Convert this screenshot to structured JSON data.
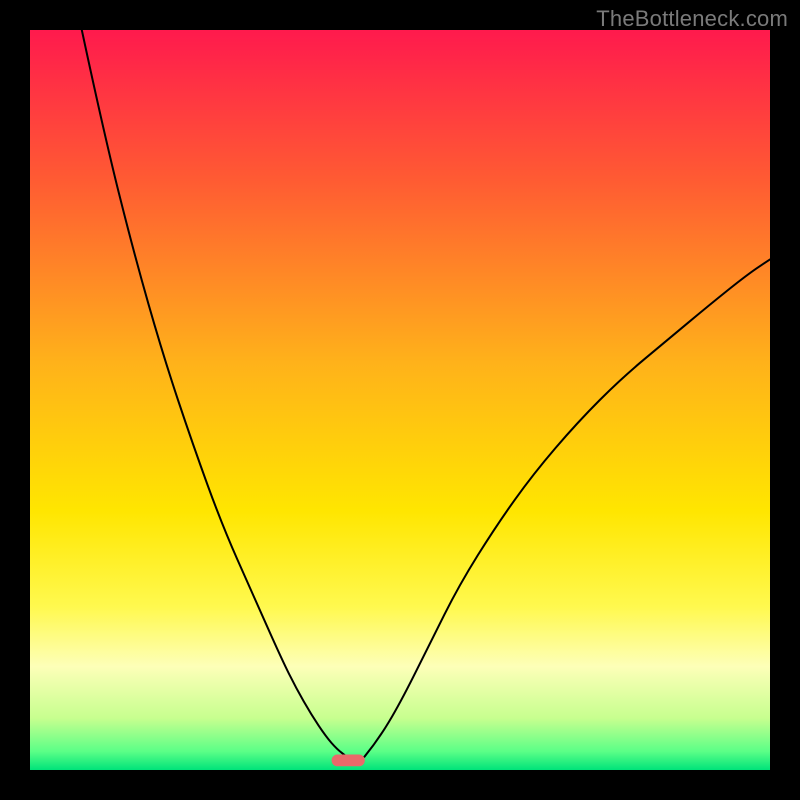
{
  "watermark": "TheBottleneck.com",
  "chart_data": {
    "type": "line",
    "title": "",
    "xlabel": "",
    "ylabel": "",
    "xlim": [
      0,
      100
    ],
    "ylim": [
      0,
      100
    ],
    "grid": false,
    "legend": false,
    "background_gradient_stops": [
      {
        "offset": 0.0,
        "color": "#ff1a4d"
      },
      {
        "offset": 0.2,
        "color": "#ff5a33"
      },
      {
        "offset": 0.45,
        "color": "#ffb21a"
      },
      {
        "offset": 0.65,
        "color": "#ffe600"
      },
      {
        "offset": 0.78,
        "color": "#fff94f"
      },
      {
        "offset": 0.86,
        "color": "#fdffb8"
      },
      {
        "offset": 0.93,
        "color": "#c7ff8f"
      },
      {
        "offset": 0.975,
        "color": "#5bff87"
      },
      {
        "offset": 1.0,
        "color": "#00e37a"
      }
    ],
    "optimum_marker": {
      "x": 43,
      "y": 1.3,
      "width": 4.5,
      "height": 1.6,
      "color": "#e96a6a"
    },
    "series": [
      {
        "name": "left-curve",
        "color": "#000000",
        "stroke_width": 2,
        "x": [
          7.0,
          10,
          14,
          18,
          22,
          26,
          30,
          34,
          36,
          38,
          40,
          41.5,
          42.8
        ],
        "y": [
          100,
          86,
          70,
          56,
          44,
          33,
          24,
          15,
          11,
          7.5,
          4.5,
          2.8,
          1.8
        ]
      },
      {
        "name": "right-curve",
        "color": "#000000",
        "stroke_width": 2,
        "x": [
          45.2,
          47,
          50,
          54,
          58,
          63,
          68,
          74,
          80,
          86,
          92,
          97,
          100
        ],
        "y": [
          1.8,
          4.0,
          9.0,
          17,
          25,
          33,
          40,
          47,
          53,
          58,
          63,
          67,
          69
        ]
      }
    ]
  }
}
